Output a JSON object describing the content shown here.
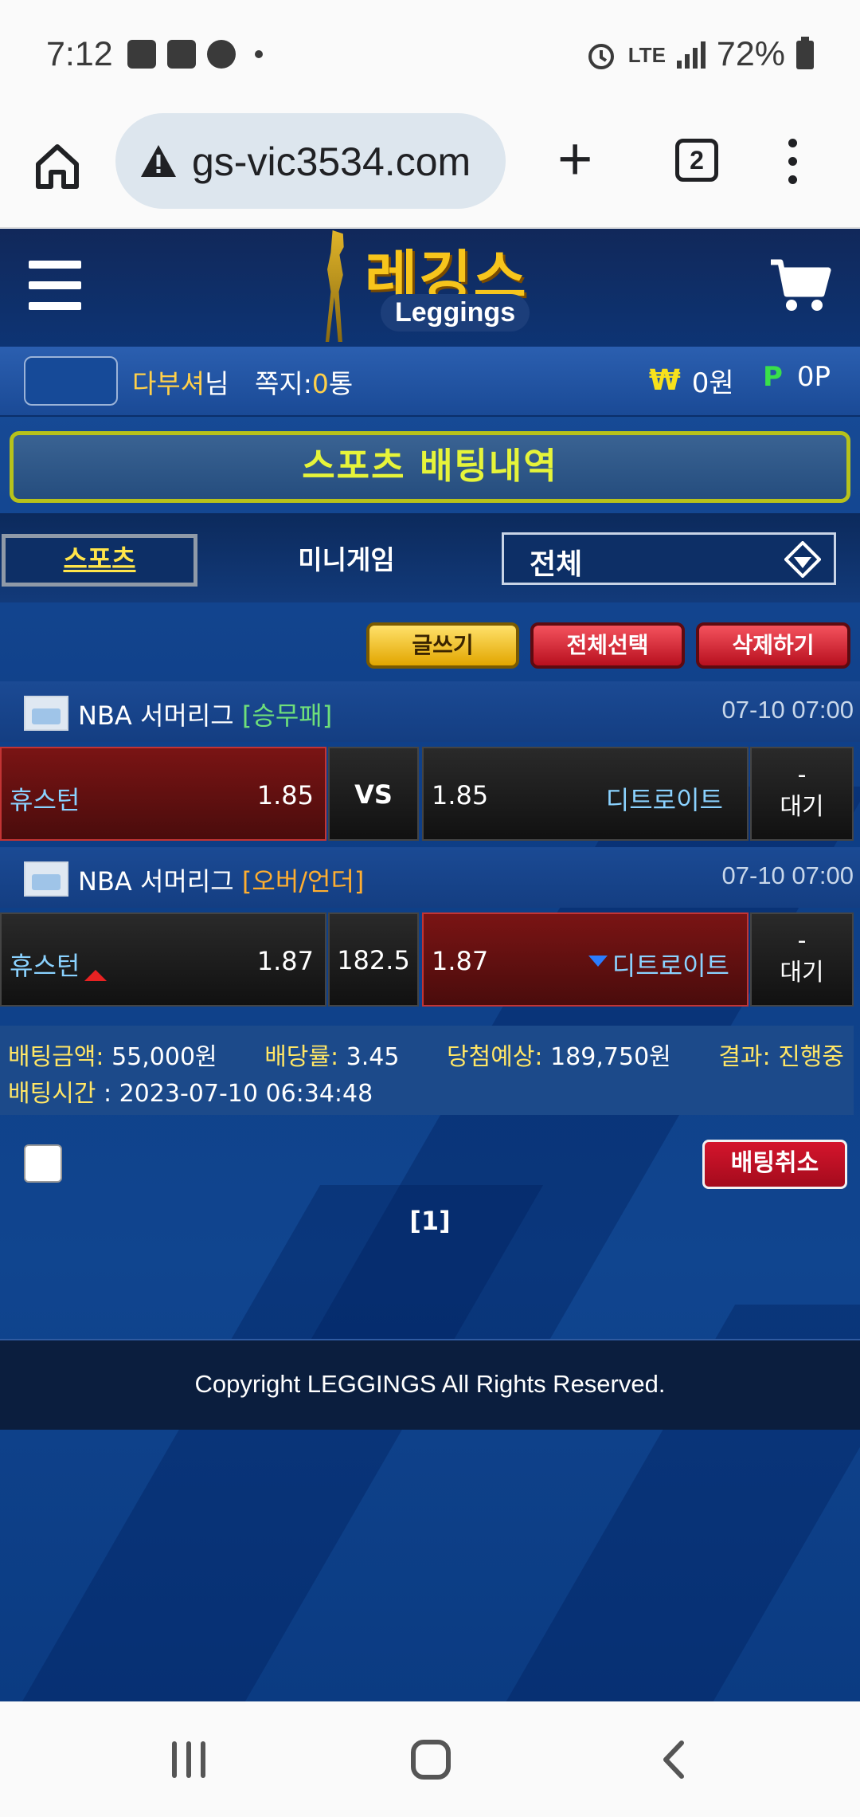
{
  "status_bar": {
    "time": "7:12",
    "network": "LTE",
    "battery": "72%"
  },
  "browser": {
    "url": "gs-vic3534.com",
    "tab_count": "2"
  },
  "site": {
    "logo_kr": "레깅스",
    "logo_en": "Leggings",
    "user": {
      "nickname": "다부셔",
      "honorific": "님",
      "messages_label": "쪽지:",
      "messages_count": "0",
      "messages_unit": "통",
      "money_symbol": "₩",
      "money": "0원",
      "points_symbol": "P",
      "points": "0P"
    },
    "page_title": "스포츠 배팅내역",
    "tabs": {
      "sports": "스포츠",
      "minigame": "미니게임"
    },
    "filter": {
      "selected": "전체"
    },
    "actions": {
      "write": "글쓰기",
      "select_all": "전체선택",
      "delete": "삭제하기"
    },
    "bets": [
      {
        "league": "NBA 서머리그",
        "bet_type": "[승무패]",
        "date": "07-10 07:00",
        "home_team": "휴스턴",
        "home_odds": "1.85",
        "middle": "VS",
        "away_odds": "1.85",
        "away_team": "디트로이트",
        "score": "-",
        "status": "대기"
      },
      {
        "league": "NBA 서머리그",
        "bet_type": "[오버/언더]",
        "date": "07-10 07:00",
        "home_team": "휴스턴",
        "home_odds": "1.87",
        "middle": "182.5",
        "away_odds": "1.87",
        "away_team": "디트로이트",
        "score": "-",
        "status": "대기"
      }
    ],
    "summary": {
      "amount_label": "배팅금액:",
      "amount": "55,000원",
      "odds_label": "배당률:",
      "odds": "3.45",
      "expected_label": "당첨예상:",
      "expected": "189,750원",
      "result_label": "결과:",
      "result": "진행중",
      "time_label": "배팅시간",
      "time": "2023-07-10 06:34:48"
    },
    "cancel_button": "배팅취소",
    "pagination": "[1]",
    "footer": "Copyright LEGGINGS All Rights Reserved."
  },
  "colors": {
    "site_bg": "#10458f",
    "accent_yellow": "#f7c51c",
    "selected_bet": "#7a1414",
    "title_text": "#e6f43a"
  }
}
